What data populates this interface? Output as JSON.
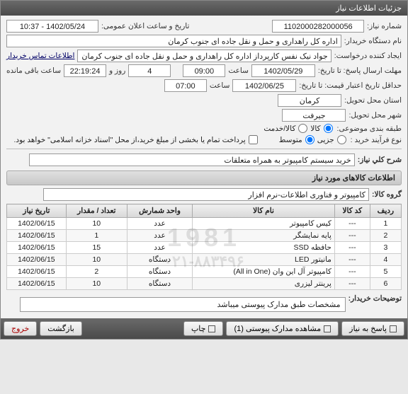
{
  "window": {
    "title": "جزئیات اطلاعات نیاز"
  },
  "labels": {
    "need_no": "شماره نیاز:",
    "datetime_pub": "تاریخ و ساعت اعلان عمومی:",
    "buyer_org": "نام دستگاه خریدار:",
    "creator": "ایجاد کننده درخواست:",
    "contact_info": "اطلاعات تماس خریدار",
    "deadline": "مهلت ارسال پاسخ: تا تاریخ:",
    "time": "ساعت",
    "day_and": "روز و",
    "time_remaining": "ساعت باقی مانده",
    "validity": "حداقل تاریخ اعتبار قیمت: تا تاریخ:",
    "province": "استان محل تحویل:",
    "city": "شهر محل تحویل:",
    "subject_cat": "طبقه بندی موضوعی:",
    "purchase_type": "نوع فرآیند خرید :",
    "payment_note": "پرداخت تمام یا بخشی از مبلغ خرید،از محل \"اسناد خزانه اسلامی\" خواهد بود.",
    "need_desc": "شرح کلي نياز:",
    "items_header": "اطلاعات کالاهای مورد نیاز",
    "item_group": "گروه کالا:",
    "buyer_notes": "توضيحات خریدار:"
  },
  "fields": {
    "need_no": "1102000282000056",
    "pub_datetime": "1402/05/24 - 10:37",
    "buyer_org": "اداره کل راهداری و حمل و نقل جاده ای جنوب کرمان",
    "creator": "جواد  نیک نفس کارپرداز اداره کل راهداری و حمل و نقل جاده ای جنوب کرمان",
    "deadline_date": "1402/05/29",
    "deadline_time": "09:00",
    "remain_days": "4",
    "remain_time": "22:19:24",
    "validity_date": "1402/06/25",
    "validity_time": "07:00",
    "province": "کرمان",
    "city": "جیرفت",
    "need_desc": "خرید سیستم کامپیوتر به همراه متعلقات",
    "item_group": "کامپیوتر و فناوری اطلاعات-نرم افزار",
    "buyer_notes": "مشخصات طبق مدارک پیوستی میباشد"
  },
  "subject_cat": {
    "opt_goods": "کالا",
    "opt_service": "کالا/خدمت",
    "selected": "goods"
  },
  "purchase_type": {
    "opt_low": "جزیی",
    "opt_mid": "متوسط",
    "selected": "mid"
  },
  "table": {
    "headers": {
      "row": "ردیف",
      "code": "کد کالا",
      "name": "نام کالا",
      "unit": "واحد شمارش",
      "qty": "تعداد / مقدار",
      "date": "تاریخ نیاز"
    },
    "rows": [
      {
        "row": "1",
        "code": "---",
        "name": "کیس کامپیوتر",
        "unit": "عدد",
        "qty": "10",
        "date": "1402/06/15"
      },
      {
        "row": "2",
        "code": "---",
        "name": "پایه نمایشگر",
        "unit": "عدد",
        "qty": "1",
        "date": "1402/06/15"
      },
      {
        "row": "3",
        "code": "---",
        "name": "حافظه SSD",
        "unit": "عدد",
        "qty": "15",
        "date": "1402/06/15"
      },
      {
        "row": "4",
        "code": "---",
        "name": "مانیتور LED",
        "unit": "دستگاه",
        "qty": "10",
        "date": "1402/06/15"
      },
      {
        "row": "5",
        "code": "---",
        "name": "کامپیوتر آل این وان (All in One)",
        "unit": "دستگاه",
        "qty": "2",
        "date": "1402/06/15"
      },
      {
        "row": "6",
        "code": "---",
        "name": "پرینتر لیزری",
        "unit": "دستگاه",
        "qty": "10",
        "date": "1402/06/15"
      }
    ]
  },
  "watermark": {
    "num": "1981",
    "phone": "۰۲۱-۸۸۳۴۹۶"
  },
  "footer": {
    "reply": "پاسخ به نیاز",
    "attachments": "مشاهده مدارک پیوستی (1)",
    "print": "چاپ",
    "back": "بازگشت",
    "exit": "خروج"
  }
}
